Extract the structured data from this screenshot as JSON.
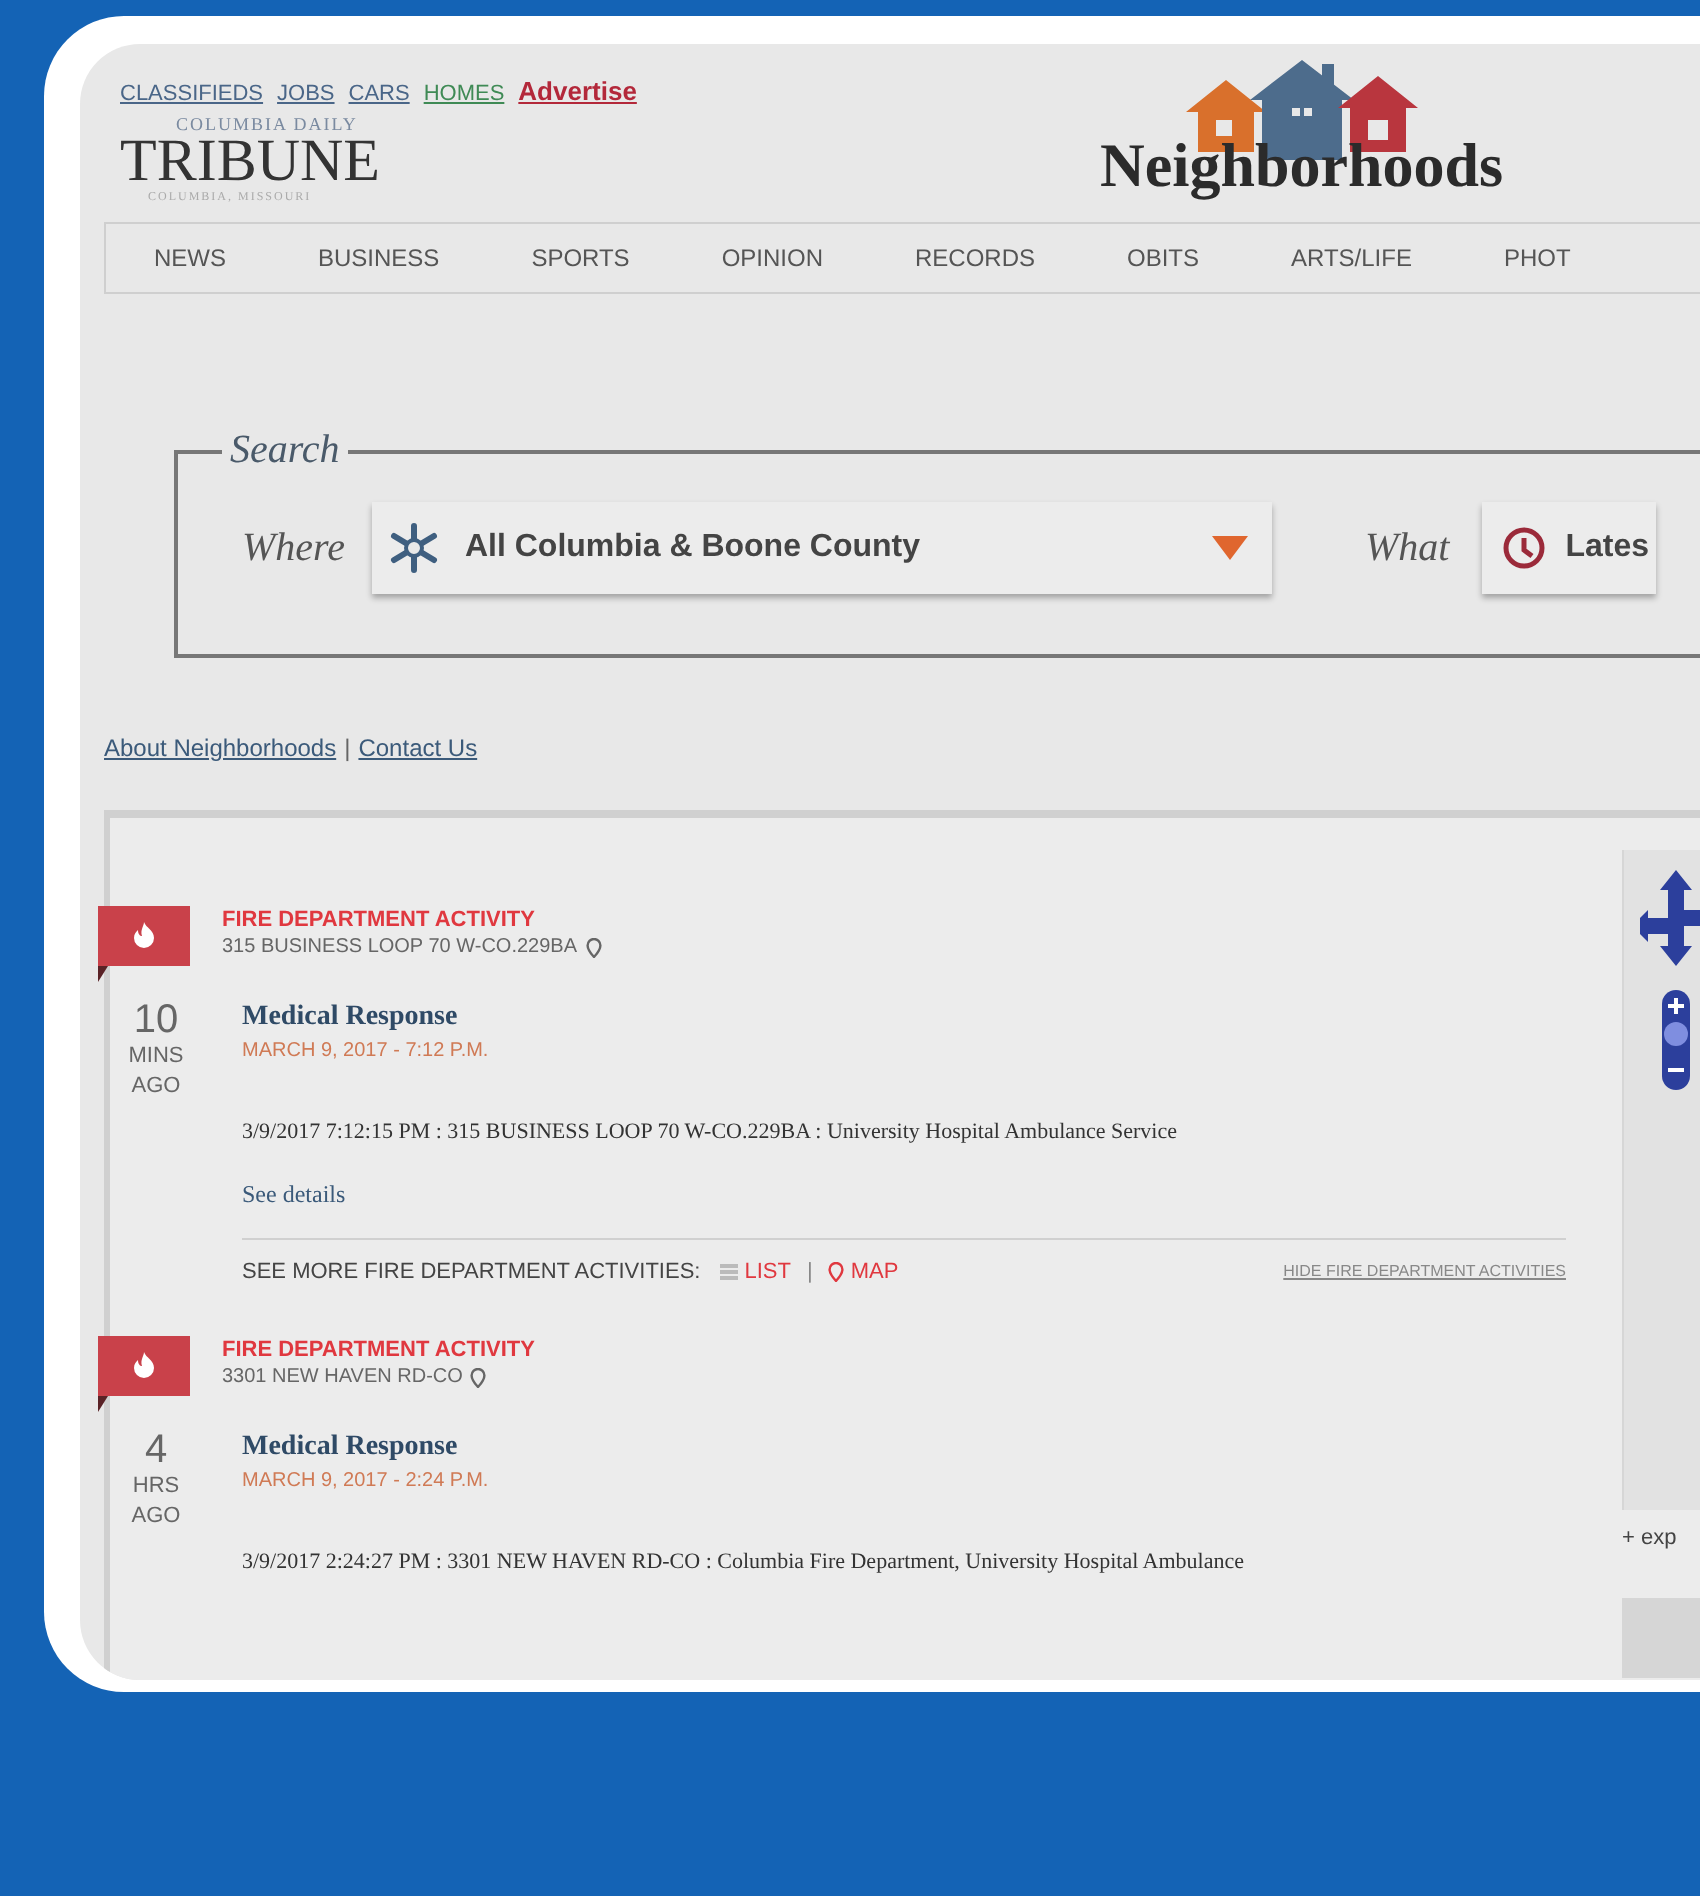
{
  "top_links": [
    {
      "label": "CLASSIFIEDS",
      "color": "#4a6688"
    },
    {
      "label": "JOBS",
      "color": "#4a6688"
    },
    {
      "label": "CARS",
      "color": "#4a6688"
    },
    {
      "label": "HOMES",
      "color": "#3f8a55"
    },
    {
      "label": "Advertise",
      "color": "#b3283a"
    }
  ],
  "masthead": {
    "tagline_top": "COLUMBIA DAILY",
    "name": "TRIBUNE",
    "tagline_bottom": "COLUMBIA, MISSOURI"
  },
  "section_title": "Neighborhoods",
  "nav": [
    "NEWS",
    "BUSINESS",
    "SPORTS",
    "OPINION",
    "RECORDS",
    "OBITS",
    "ARTS/LIFE",
    "PHOT"
  ],
  "search": {
    "legend": "Search",
    "where_label": "Where",
    "where_value": "All Columbia & Boone County",
    "what_label": "What",
    "what_value": "Lates"
  },
  "footer_links": {
    "items": [
      "About Neighborhoods",
      "Contact Us"
    ],
    "separator": "|"
  },
  "activities": [
    {
      "category": "FIRE DEPARTMENT ACTIVITY",
      "address": "315 BUSINESS LOOP 70 W-CO.229BA",
      "age_number": "10",
      "age_unit": "MINS",
      "age_suffix": "AGO",
      "title": "Medical Response",
      "date": "MARCH 9, 2017 - 7:12 P.M.",
      "description": "3/9/2017 7:12:15 PM : 315 BUSINESS LOOP 70 W-CO.229BA : University Hospital Ambulance Service",
      "details_link": "See details",
      "more": {
        "label": "SEE MORE FIRE DEPARTMENT ACTIVITIES:",
        "list": "LIST",
        "separator": "|",
        "map": "MAP",
        "hide": "HIDE FIRE DEPARTMENT ACTIVITIES"
      }
    },
    {
      "category": "FIRE DEPARTMENT ACTIVITY",
      "address": "3301 NEW HAVEN RD-CO",
      "age_number": "4",
      "age_unit": "HRS",
      "age_suffix": "AGO",
      "title": "Medical Response",
      "date": "MARCH 9, 2017 - 2:24 P.M.",
      "description": "3/9/2017 2:24:27 PM : 3301 NEW HAVEN RD-CO : Columbia Fire Department, University Hospital Ambulance"
    }
  ],
  "map": {
    "expand_link": "+ exp"
  }
}
